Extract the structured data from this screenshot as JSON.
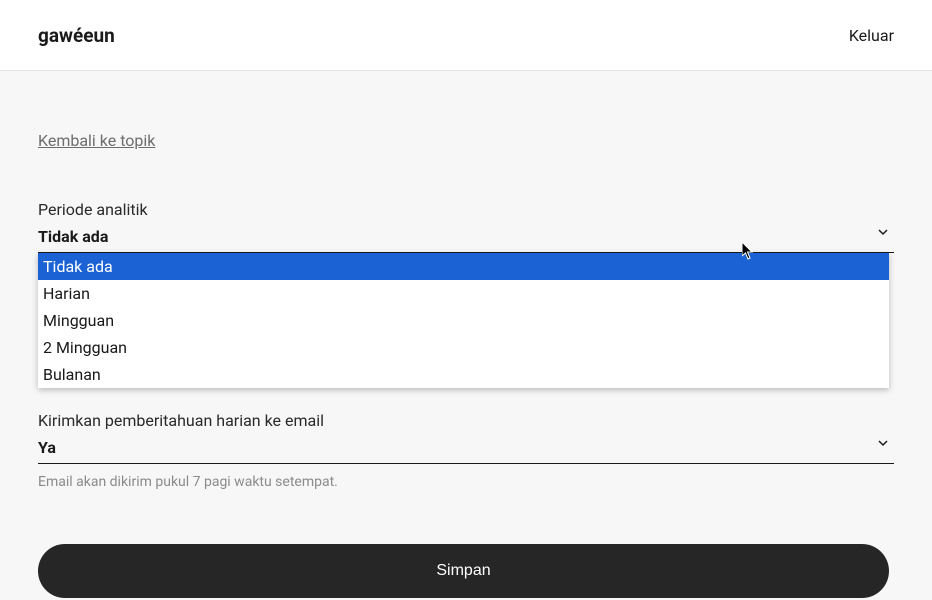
{
  "header": {
    "logo": "gawéeun",
    "logout": "Keluar"
  },
  "nav": {
    "back_link": "Kembali ke topik"
  },
  "form": {
    "period": {
      "label": "Periode analitik",
      "value": "Tidak ada",
      "options": [
        "Tidak ada",
        "Harian",
        "Mingguan",
        "2 Mingguan",
        "Bulanan"
      ]
    },
    "daily_email": {
      "label": "Kirimkan pemberitahuan harian ke email",
      "value": "Ya",
      "help": "Email akan dikirim pukul 7 pagi waktu setempat."
    },
    "save_label": "Simpan"
  }
}
